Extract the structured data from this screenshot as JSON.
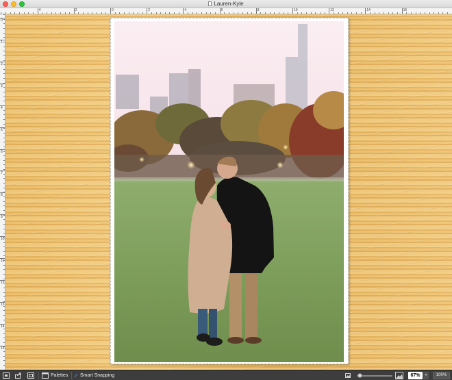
{
  "window": {
    "title": "Lauren-Kyle"
  },
  "ruler": {
    "corner_label": "in",
    "h_labels": [
      "4",
      "2",
      "0",
      "2",
      "4",
      "6",
      "8",
      "10",
      "12",
      "14",
      "16"
    ],
    "v_labels": [
      "0",
      "1",
      "2",
      "3",
      "4",
      "5",
      "6",
      "7",
      "8",
      "9",
      "10",
      "11",
      "12",
      "13",
      "14",
      "15"
    ]
  },
  "canvas": {
    "background": "wood-texture",
    "photo_description_hidden": true
  },
  "toolbar": {
    "palettes_label": "Palettes",
    "smart_snapping_label": "Smart Snapping",
    "smart_snapping_checked": true,
    "zoom_value": "67%",
    "zoom_slider_fraction": 0.08,
    "fit_button_label": "100%"
  },
  "colors": {
    "toolbar_bg": "#3d3d3d",
    "wood": "#e8b862",
    "close": "#fc5f57",
    "minimize": "#fdbc2e",
    "maximize": "#29c840"
  },
  "icons": [
    "share-icon",
    "fit-page-icon",
    "palettes-icon",
    "checkmark-icon",
    "small-image-icon",
    "large-image-icon",
    "chevron-down-icon"
  ]
}
